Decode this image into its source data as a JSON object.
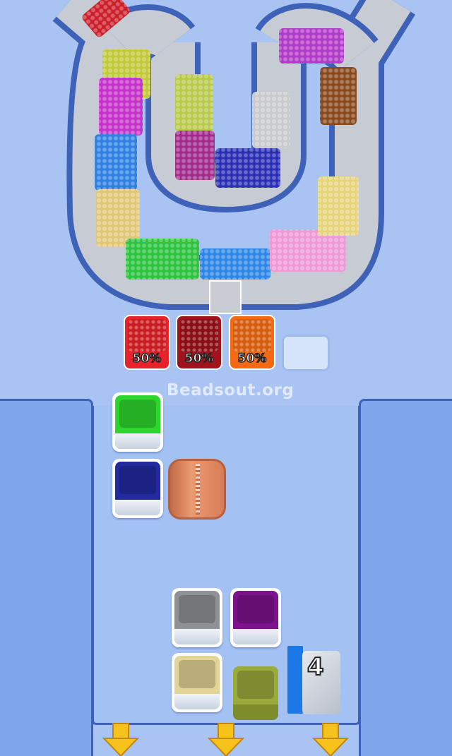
{
  "watermark": "Beadsout.org",
  "slots": [
    {
      "label": "50%",
      "color": "#e8222a"
    },
    {
      "label": "50%",
      "color": "#a0121c"
    },
    {
      "label": "50%",
      "color": "#f46a12"
    }
  ],
  "board_boxes": [
    {
      "color": "#2dd62d",
      "name": "green"
    },
    {
      "color": "#212a9e",
      "name": "navy"
    },
    {
      "color": "#8f9194",
      "name": "gray"
    },
    {
      "color": "#7d128a",
      "name": "purple"
    },
    {
      "color": "#e2d597",
      "name": "cream"
    },
    {
      "color": "#9aaa3b",
      "name": "olive"
    }
  ],
  "spool": {
    "color": "#e08b64"
  },
  "counter": {
    "value": "4"
  },
  "track_segments": [
    "#cc1f2a",
    "#c2c93a",
    "#c532c9",
    "#2f7fe0",
    "#e2c77a",
    "#2cc43e",
    "#2c86e6",
    "#f09ad8",
    "#e6d37a",
    "#8a4a1e",
    "#b23ac9",
    "#c9cbcc",
    "#b9c94b",
    "#a12a8a",
    "#2a2fb5"
  ],
  "colors": {
    "background": "#a9c4f2",
    "wall": "#7ea7ee",
    "outline": "#3e62b8",
    "arrow": "#f7c21c"
  }
}
